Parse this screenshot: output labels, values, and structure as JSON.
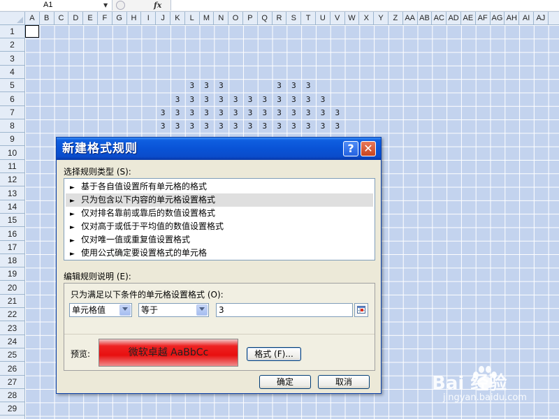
{
  "formula_bar": {
    "name_box": "A1",
    "fx_label": "fx",
    "formula": ""
  },
  "sheet": {
    "columns": [
      "A",
      "B",
      "C",
      "D",
      "E",
      "F",
      "G",
      "H",
      "I",
      "J",
      "K",
      "L",
      "M",
      "N",
      "O",
      "P",
      "Q",
      "R",
      "S",
      "T",
      "U",
      "V",
      "W",
      "X",
      "Y",
      "Z",
      "AA",
      "AB",
      "AC",
      "AD",
      "AE",
      "AF",
      "AG",
      "AH",
      "AI",
      "AJ"
    ],
    "rows": [
      "1",
      "2",
      "3",
      "4",
      "5",
      "6",
      "7",
      "8",
      "9",
      "10",
      "11",
      "12",
      "13",
      "14",
      "15",
      "16",
      "17",
      "18",
      "19",
      "20",
      "21",
      "22",
      "23",
      "24",
      "25",
      "26",
      "27",
      "28",
      "29"
    ],
    "active_cell": "A1",
    "cells": [
      {
        "row": 5,
        "col": "L",
        "value": "3"
      },
      {
        "row": 5,
        "col": "M",
        "value": "3"
      },
      {
        "row": 5,
        "col": "N",
        "value": "3"
      },
      {
        "row": 5,
        "col": "R",
        "value": "3"
      },
      {
        "row": 5,
        "col": "S",
        "value": "3"
      },
      {
        "row": 5,
        "col": "T",
        "value": "3"
      },
      {
        "row": 6,
        "col": "K",
        "value": "3"
      },
      {
        "row": 6,
        "col": "L",
        "value": "3"
      },
      {
        "row": 6,
        "col": "M",
        "value": "3"
      },
      {
        "row": 6,
        "col": "N",
        "value": "3"
      },
      {
        "row": 6,
        "col": "O",
        "value": "3"
      },
      {
        "row": 6,
        "col": "P",
        "value": "3"
      },
      {
        "row": 6,
        "col": "Q",
        "value": "3"
      },
      {
        "row": 6,
        "col": "R",
        "value": "3"
      },
      {
        "row": 6,
        "col": "S",
        "value": "3"
      },
      {
        "row": 6,
        "col": "T",
        "value": "3"
      },
      {
        "row": 6,
        "col": "U",
        "value": "3"
      },
      {
        "row": 7,
        "col": "J",
        "value": "3"
      },
      {
        "row": 7,
        "col": "K",
        "value": "3"
      },
      {
        "row": 7,
        "col": "L",
        "value": "3"
      },
      {
        "row": 7,
        "col": "M",
        "value": "3"
      },
      {
        "row": 7,
        "col": "N",
        "value": "3"
      },
      {
        "row": 7,
        "col": "O",
        "value": "3"
      },
      {
        "row": 7,
        "col": "P",
        "value": "3"
      },
      {
        "row": 7,
        "col": "Q",
        "value": "3"
      },
      {
        "row": 7,
        "col": "R",
        "value": "3"
      },
      {
        "row": 7,
        "col": "S",
        "value": "3"
      },
      {
        "row": 7,
        "col": "T",
        "value": "3"
      },
      {
        "row": 7,
        "col": "U",
        "value": "3"
      },
      {
        "row": 7,
        "col": "V",
        "value": "3"
      },
      {
        "row": 8,
        "col": "J",
        "value": "3"
      },
      {
        "row": 8,
        "col": "K",
        "value": "3"
      },
      {
        "row": 8,
        "col": "L",
        "value": "3"
      },
      {
        "row": 8,
        "col": "M",
        "value": "3"
      },
      {
        "row": 8,
        "col": "N",
        "value": "3"
      },
      {
        "row": 8,
        "col": "O",
        "value": "3"
      },
      {
        "row": 8,
        "col": "P",
        "value": "3"
      },
      {
        "row": 8,
        "col": "Q",
        "value": "3"
      },
      {
        "row": 8,
        "col": "R",
        "value": "3"
      },
      {
        "row": 8,
        "col": "S",
        "value": "3"
      },
      {
        "row": 8,
        "col": "T",
        "value": "3"
      },
      {
        "row": 8,
        "col": "U",
        "value": "3"
      },
      {
        "row": 8,
        "col": "V",
        "value": "3"
      }
    ]
  },
  "dialog": {
    "title": "新建格式规则",
    "help_label": "?",
    "close_label": "✕",
    "rule_type_label": "选择规则类型 (S):",
    "rule_types": [
      {
        "label": "基于各自值设置所有单元格的格式",
        "selected": false
      },
      {
        "label": "只为包含以下内容的单元格设置格式",
        "selected": true
      },
      {
        "label": "仅对排名靠前或靠后的数值设置格式",
        "selected": false
      },
      {
        "label": "仅对高于或低于平均值的数值设置格式",
        "selected": false
      },
      {
        "label": "仅对唯一值或重复值设置格式",
        "selected": false
      },
      {
        "label": "使用公式确定要设置格式的单元格",
        "selected": false
      }
    ],
    "rule_desc_label": "编辑规则说明 (E):",
    "condition_label": "只为满足以下条件的单元格设置格式 (O):",
    "condition_type": "单元格值",
    "operator": "等于",
    "value": "3",
    "preview_label": "预览:",
    "preview_text": "微软卓越  AaBbCc",
    "format_button": "格式 (F)...",
    "ok_button": "确定",
    "cancel_button": "取消",
    "colors": {
      "title_bar": "#0953d6",
      "preview_fill": "#e81010"
    }
  },
  "watermark": {
    "main": "Bai  经验",
    "sub": "jingyan.baidu.com"
  }
}
